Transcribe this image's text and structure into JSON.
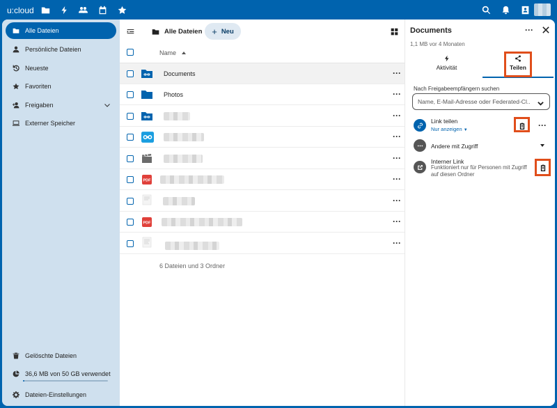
{
  "app": {
    "brand": "u:cloud",
    "top_nav_icons": [
      "files-icon",
      "activity-icon",
      "contacts-icon",
      "calendar-icon",
      "favorites-icon"
    ],
    "top_right_icons": [
      "search-icon",
      "notifications-icon",
      "contacts-menu-icon",
      "user-avatar"
    ],
    "accent_color": "#0063ae",
    "highlight_color": "#e04e1b"
  },
  "sidebar": {
    "items": [
      {
        "label": "Alle Dateien",
        "icon": "folder-icon",
        "active": true
      },
      {
        "label": "Persönliche Dateien",
        "icon": "user-icon",
        "active": false
      },
      {
        "label": "Neueste",
        "icon": "history-icon",
        "active": false
      },
      {
        "label": "Favoriten",
        "icon": "star-icon",
        "active": false
      },
      {
        "label": "Freigaben",
        "icon": "share-icon",
        "active": false
      },
      {
        "label": "Externer Speicher",
        "icon": "external-storage-icon",
        "active": false
      }
    ],
    "bottom": {
      "trash": "Gelöschte Dateien",
      "quota": "36,6 MB von 50 GB verwendet",
      "quota_used_fraction": 0.01,
      "settings": "Dateien-Einstellungen"
    }
  },
  "main": {
    "breadcrumb": "Alle Dateien",
    "new_button": "Neu",
    "column_name": "Name",
    "files": [
      {
        "name": "Documents",
        "type": "folder-shared",
        "blurred": false
      },
      {
        "name": "Photos",
        "type": "folder",
        "blurred": false
      },
      {
        "name": "",
        "type": "folder-shared",
        "blurred": true
      },
      {
        "name": "",
        "type": "folder-external",
        "blurred": true
      },
      {
        "name": "",
        "type": "video",
        "blurred": true
      },
      {
        "name": "",
        "type": "pdf",
        "blurred": true
      },
      {
        "name": "",
        "type": "document",
        "blurred": true
      },
      {
        "name": "",
        "type": "pdf",
        "blurred": true
      },
      {
        "name": "",
        "type": "document",
        "blurred": true
      }
    ],
    "summary": "6 Dateien und 3 Ordner"
  },
  "panel": {
    "title": "Documents",
    "meta": "1,1 MB vor 4 Monaten",
    "tabs": [
      {
        "label": "Aktivität",
        "icon": "activity-icon",
        "active": false
      },
      {
        "label": "Teilen",
        "icon": "share-icon",
        "active": true
      }
    ],
    "search_label": "Nach Freigabeempfängern suchen",
    "search_placeholder": "Name, E-Mail-Adresse oder Federated-Cl...",
    "link_share": {
      "title": "Link teilen",
      "subtitle": "Nur anzeigen"
    },
    "others_with_access": "Andere mit Zugriff",
    "internal_link": {
      "title": "Interner Link",
      "description": "Funktioniert nur für Personen mit Zugriff auf diesen Ordner"
    }
  }
}
